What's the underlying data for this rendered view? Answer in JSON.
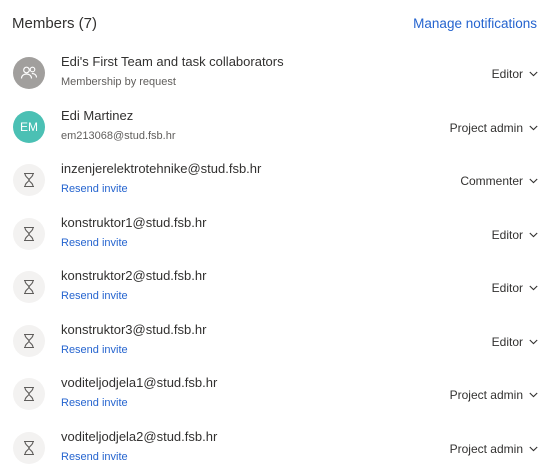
{
  "header": {
    "title": "Members (7)",
    "manage_link": "Manage notifications"
  },
  "members": [
    {
      "type": "group",
      "avatar_icon": "group-icon",
      "name": "Edi's First Team and task collaborators",
      "subtitle": "Membership by request",
      "role": "Editor"
    },
    {
      "type": "user",
      "initials": "EM",
      "name": "Edi Martinez",
      "subtitle": "em213068@stud.fsb.hr",
      "role": "Project admin"
    },
    {
      "type": "pending",
      "avatar_icon": "hourglass-icon",
      "name": "inzenjerelektrotehnike@stud.fsb.hr",
      "subtitle": "Resend invite",
      "role": "Commenter"
    },
    {
      "type": "pending",
      "avatar_icon": "hourglass-icon",
      "name": "konstruktor1@stud.fsb.hr",
      "subtitle": "Resend invite",
      "role": "Editor"
    },
    {
      "type": "pending",
      "avatar_icon": "hourglass-icon",
      "name": "konstruktor2@stud.fsb.hr",
      "subtitle": "Resend invite",
      "role": "Editor"
    },
    {
      "type": "pending",
      "avatar_icon": "hourglass-icon",
      "name": "konstruktor3@stud.fsb.hr",
      "subtitle": "Resend invite",
      "role": "Editor"
    },
    {
      "type": "pending",
      "avatar_icon": "hourglass-icon",
      "name": "voditeljodjela1@stud.fsb.hr",
      "subtitle": "Resend invite",
      "role": "Project admin"
    },
    {
      "type": "pending",
      "avatar_icon": "hourglass-icon",
      "name": "voditeljodjela2@stud.fsb.hr",
      "subtitle": "Resend invite",
      "role": "Project admin"
    }
  ],
  "colors": {
    "link": "#2564cf",
    "text": "#323130",
    "subtext": "#605e5c",
    "avatar_group": "#a19f9d",
    "avatar_initials": "#4bc0b4",
    "avatar_pending": "#f3f2f1"
  }
}
